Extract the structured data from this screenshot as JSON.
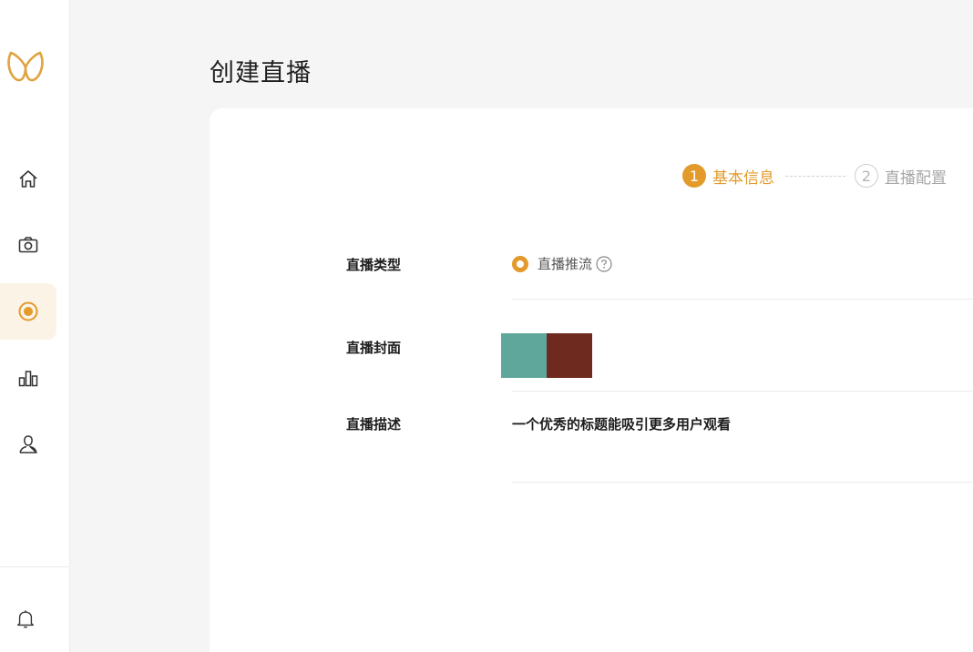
{
  "page": {
    "title": "创建直播"
  },
  "sidebar": {
    "logo": "brand-logo",
    "items": [
      {
        "icon": "home-icon",
        "active": false
      },
      {
        "icon": "camera-icon",
        "active": false
      },
      {
        "icon": "live-record-icon",
        "active": true
      },
      {
        "icon": "bar-chart-icon",
        "active": false
      },
      {
        "icon": "user-icon",
        "active": false
      }
    ],
    "bottom": {
      "icon": "bell-icon"
    }
  },
  "steps": [
    {
      "number": "1",
      "label": "基本信息",
      "active": true
    },
    {
      "number": "2",
      "label": "直播配置",
      "active": false
    }
  ],
  "form": {
    "type": {
      "label": "直播类型",
      "option": "直播推流",
      "selected": true
    },
    "cover": {
      "label": "直播封面",
      "colors": [
        "#5fa79a",
        "#6e2a1e"
      ]
    },
    "description": {
      "label": "直播描述",
      "value": "一个优秀的标题能吸引更多用户观看"
    }
  },
  "colors": {
    "accent": "#e39a2b",
    "background": "#f5f5f5",
    "card": "#ffffff"
  }
}
